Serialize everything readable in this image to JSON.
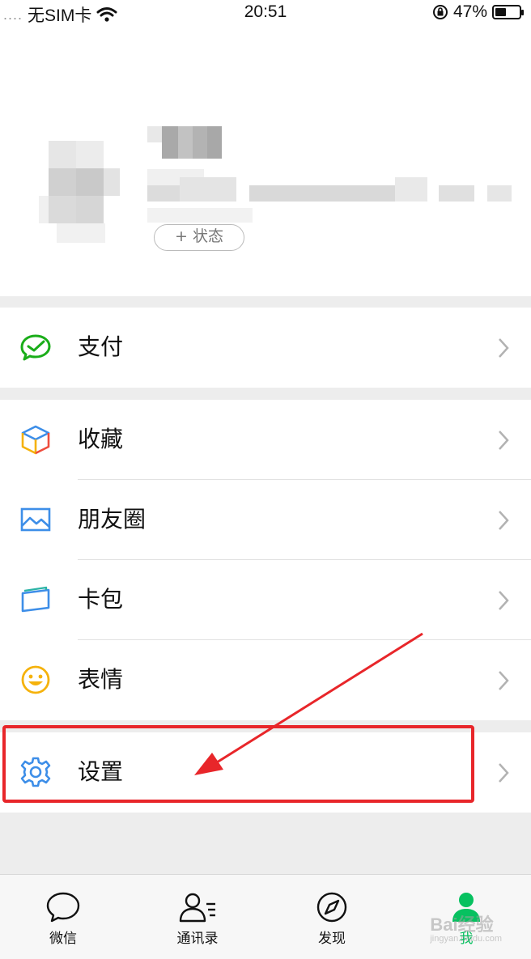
{
  "status_bar": {
    "signal_dots": "....",
    "carrier": "无SIM卡",
    "wifi_icon": "wifi-icon",
    "time": "20:51",
    "orientation_lock_icon": "orientation-lock-icon",
    "battery_percent": "47%",
    "battery_level": 0.47
  },
  "profile": {
    "status_button_label": "+ 状态"
  },
  "menu": {
    "pay": {
      "label": "支付",
      "icon": "wechat-pay-icon"
    },
    "favorites": {
      "label": "收藏",
      "icon": "favorites-cube-icon"
    },
    "moments": {
      "label": "朋友圈",
      "icon": "moments-picture-icon"
    },
    "card_wallet": {
      "label": "卡包",
      "icon": "card-wallet-icon"
    },
    "stickers": {
      "label": "表情",
      "icon": "smiley-icon"
    },
    "settings": {
      "label": "设置",
      "icon": "gear-icon"
    }
  },
  "annotation": {
    "highlight_color": "#e8262a"
  },
  "tab_bar": {
    "tabs": [
      {
        "label": "微信",
        "icon": "chat-bubble-icon"
      },
      {
        "label": "通讯录",
        "icon": "contacts-icon"
      },
      {
        "label": "发现",
        "icon": "compass-icon"
      },
      {
        "label": "我",
        "icon": "person-icon",
        "active": true
      }
    ],
    "active_color": "#07c160"
  },
  "watermark": {
    "brand": "Bai经验",
    "url": "jingyan.baidu.com"
  }
}
